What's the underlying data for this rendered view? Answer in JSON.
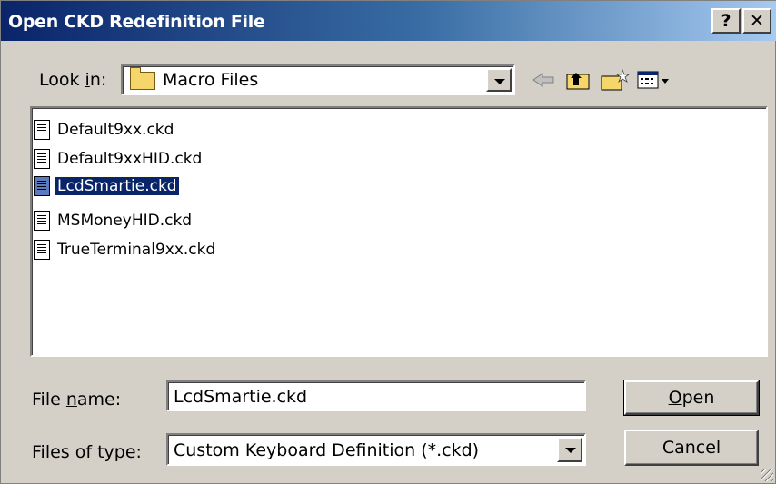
{
  "window": {
    "title": "Open CKD Redefinition File",
    "help_label": "?",
    "close_label": "✕"
  },
  "look_in": {
    "label_prefix": "Look ",
    "label_underlined": "i",
    "label_suffix": "n:",
    "value": "Macro Files"
  },
  "toolbar": {
    "back_icon": "back-arrow-icon",
    "up_icon": "up-folder-icon",
    "new_folder_icon": "new-folder-icon",
    "views_icon": "views-menu-icon"
  },
  "files": [
    {
      "name": "Default9xx.ckd",
      "selected": false
    },
    {
      "name": "Default9xxHID.ckd",
      "selected": false
    },
    {
      "name": "LcdSmartie.ckd",
      "selected": true
    },
    {
      "name": "MSMoneyHID.ckd",
      "selected": false
    },
    {
      "name": "TrueTerminal9xx.ckd",
      "selected": false
    }
  ],
  "file_name": {
    "label_prefix": "File ",
    "label_underlined": "n",
    "label_suffix": "ame:",
    "value": "LcdSmartie.ckd"
  },
  "file_type": {
    "label_prefix": "Files of ",
    "label_underlined": "t",
    "label_suffix": "ype:",
    "value": "Custom Keyboard Definition (*.ckd)"
  },
  "buttons": {
    "open_underlined": "O",
    "open_rest": "pen",
    "cancel": "Cancel"
  },
  "colors": {
    "title_start": "#0a246a",
    "title_end": "#a6caf0",
    "selection": "#0a246a",
    "face": "#d4d0c8"
  }
}
